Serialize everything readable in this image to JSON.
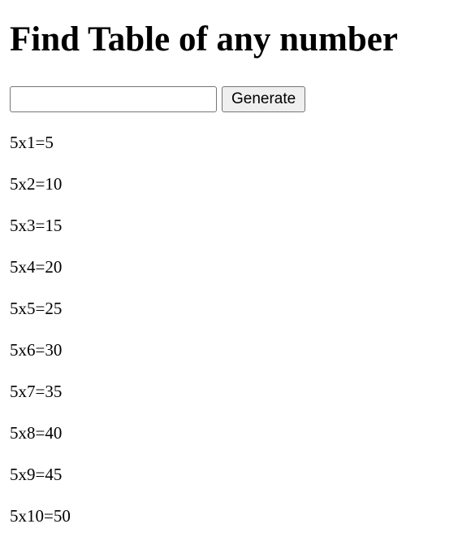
{
  "page": {
    "title": "Find Table of any number"
  },
  "form": {
    "input_value": "",
    "input_placeholder": "",
    "generate_label": "Generate"
  },
  "results": [
    "5x1=5",
    "5x2=10",
    "5x3=15",
    "5x4=20",
    "5x5=25",
    "5x6=30",
    "5x7=35",
    "5x8=40",
    "5x9=45",
    "5x10=50"
  ]
}
